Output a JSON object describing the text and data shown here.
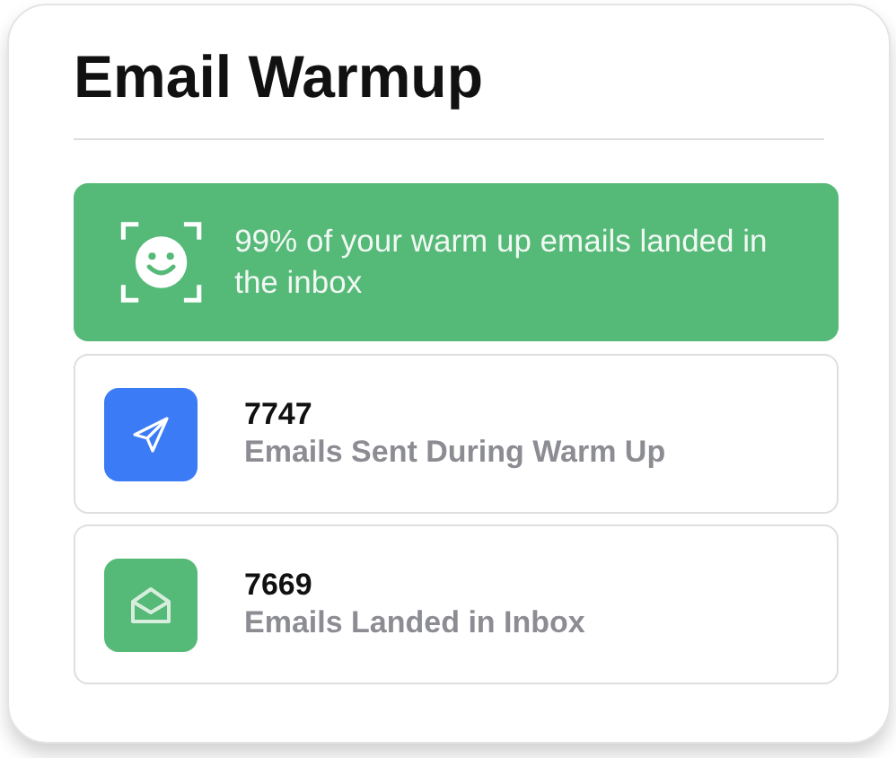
{
  "title": "Email Warmup",
  "banner": {
    "text": "99% of your warm up emails landed in the inbox"
  },
  "stats": [
    {
      "kind": "send",
      "color": "#3b7bf6",
      "value": "7747",
      "label": "Emails Sent During Warm Up"
    },
    {
      "kind": "envelope",
      "color": "#55b977",
      "value": "7669",
      "label": "Emails Landed in Inbox"
    }
  ]
}
